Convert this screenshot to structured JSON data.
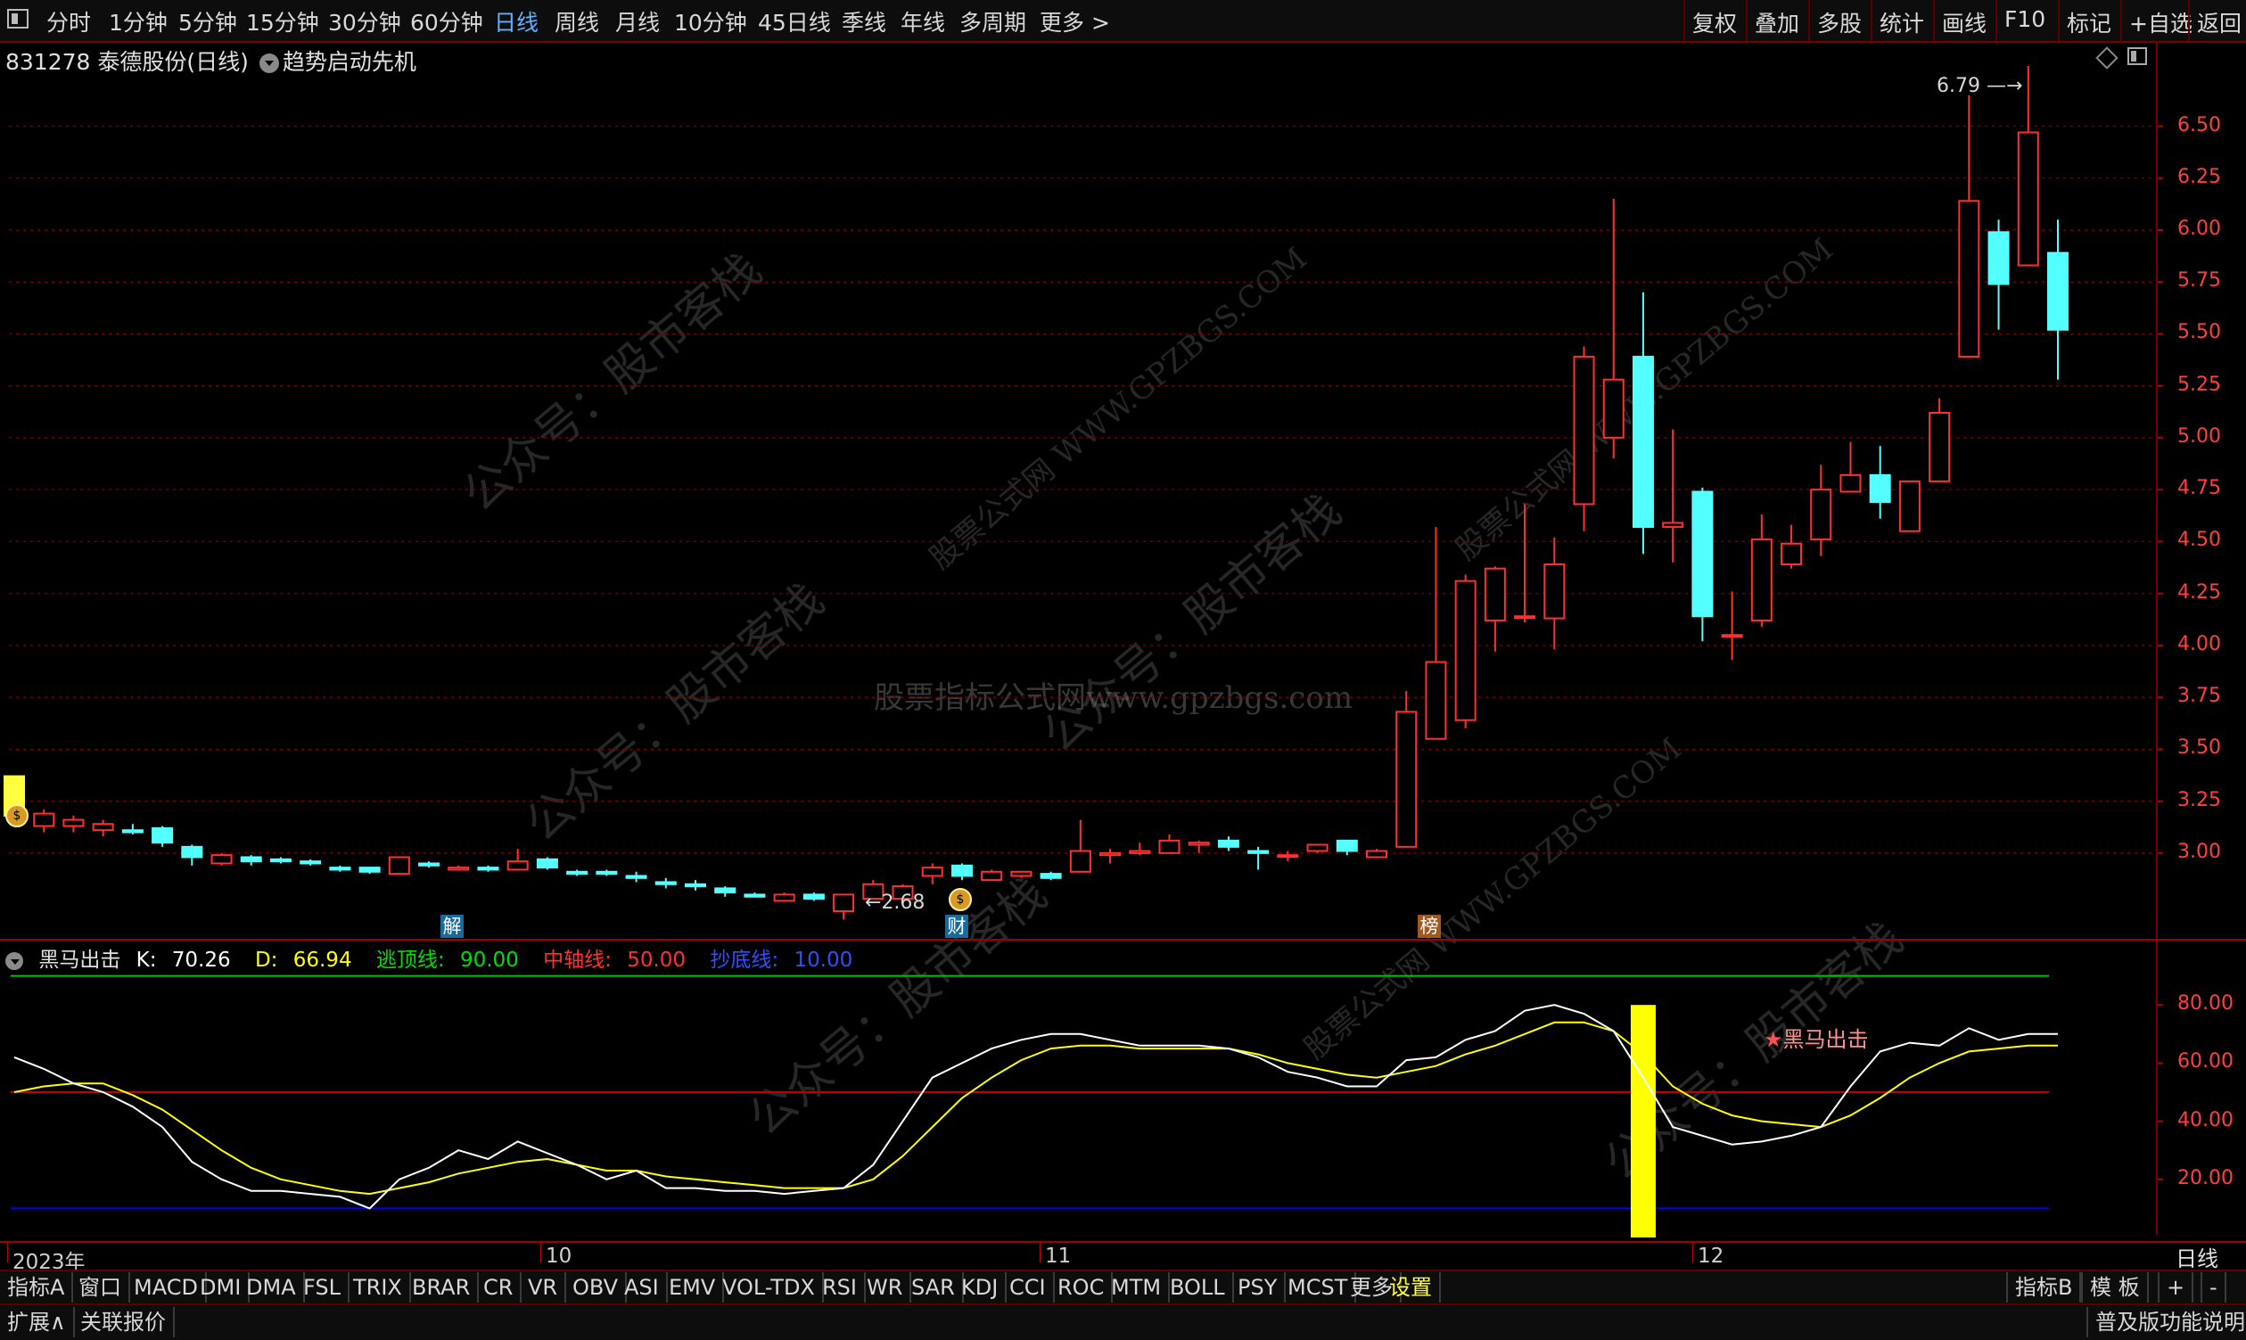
{
  "toolbar": {
    "periods": [
      "分时",
      "1分钟",
      "5分钟",
      "15分钟",
      "30分钟",
      "60分钟",
      "日线",
      "周线",
      "月线",
      "10分钟",
      "45日线",
      "季线",
      "年线",
      "多周期",
      "更多 >"
    ],
    "active_period": "日线",
    "right_buttons": [
      "复权",
      "叠加",
      "多股",
      "统计",
      "画线",
      "F10",
      "标记",
      "+自选",
      "返回"
    ]
  },
  "stock": {
    "code": "831278",
    "name": "泰德股份(日线)",
    "formula": "趋势启动先机"
  },
  "price_axis": {
    "labels": [
      "6.50",
      "6.25",
      "6.00",
      "5.75",
      "5.50",
      "5.25",
      "5.00",
      "4.75",
      "4.50",
      "4.25",
      "4.00",
      "3.75",
      "3.50",
      "3.25",
      "3.00"
    ]
  },
  "annotations": {
    "high": "6.79",
    "low": "2.68",
    "marker_jie": "解",
    "marker_cai": "财",
    "marker_bang": "榜",
    "signal_label": "黑马出击"
  },
  "indicator": {
    "name": "黑马出击",
    "k_label": "K:",
    "k_value": "70.26",
    "d_label": "D:",
    "d_value": "66.94",
    "top_label": "逃顶线:",
    "top_value": "90.00",
    "mid_label": "中轴线:",
    "mid_value": "50.00",
    "bottom_label": "抄底线:",
    "bottom_value": "10.00",
    "axis_labels": [
      "80.00",
      "60.00",
      "40.00",
      "20.00"
    ]
  },
  "time_axis": {
    "labels": [
      "2023年",
      "10",
      "11",
      "12"
    ],
    "right_label": "日线"
  },
  "indicator_tabs": [
    "指标A",
    "窗口",
    "MACD",
    "DMI",
    "DMA",
    "FSL",
    "TRIX",
    "BRAR",
    "CR",
    "VR",
    "OBV",
    "ASI",
    "EMV",
    "VOL-TDX",
    "RSI",
    "WR",
    "SAR",
    "KDJ",
    "CCI",
    "ROC",
    "MTM",
    "BOLL",
    "PSY",
    "MCST",
    "更多",
    "设置"
  ],
  "indicator_tabs_right": [
    "指标B",
    "模 板",
    "+",
    "-"
  ],
  "status_bar": {
    "left": [
      "扩展∧",
      "关联报价"
    ],
    "right": "普及版功能说明"
  },
  "watermarks": [
    "公众号：股市客栈",
    "股票公式网 WWW.GPZBGS.COM",
    "股票指标公式网www.gpzbgs.com"
  ],
  "colors": {
    "up": "#ff3030",
    "down": "#54ffff",
    "k_line": "#ffffff",
    "d_line": "#ffff00",
    "top_line": "#00c000",
    "mid_line": "#c00000",
    "bottom_line": "#0000ff",
    "signal_bar": "#ffff00",
    "grid": "#7a0000"
  },
  "chart_data": {
    "type": "candlestick",
    "price_ylim": [
      2.6,
      6.85
    ],
    "candles": [
      [
        3.37,
        3.18,
        3.37,
        3.16
      ],
      [
        3.13,
        3.19,
        3.21,
        3.1
      ],
      [
        3.13,
        3.16,
        3.18,
        3.1
      ],
      [
        3.11,
        3.14,
        3.16,
        3.08
      ],
      [
        3.11,
        3.1,
        3.14,
        3.09
      ],
      [
        3.12,
        3.05,
        3.13,
        3.03
      ],
      [
        3.03,
        2.98,
        3.04,
        2.94
      ],
      [
        2.95,
        2.99,
        3.0,
        2.94
      ],
      [
        2.98,
        2.96,
        2.99,
        2.94
      ],
      [
        2.97,
        2.96,
        2.98,
        2.95
      ],
      [
        2.96,
        2.95,
        2.97,
        2.94
      ],
      [
        2.93,
        2.92,
        2.94,
        2.91
      ],
      [
        2.93,
        2.91,
        2.93,
        2.9
      ],
      [
        2.9,
        2.98,
        2.98,
        2.9
      ],
      [
        2.95,
        2.94,
        2.96,
        2.93
      ],
      [
        2.92,
        2.93,
        2.94,
        2.92
      ],
      [
        2.93,
        2.92,
        2.94,
        2.91
      ],
      [
        2.92,
        2.96,
        3.02,
        2.92
      ],
      [
        2.97,
        2.93,
        2.98,
        2.92
      ],
      [
        2.91,
        2.9,
        2.92,
        2.89
      ],
      [
        2.91,
        2.9,
        2.92,
        2.89
      ],
      [
        2.89,
        2.88,
        2.91,
        2.86
      ],
      [
        2.86,
        2.85,
        2.88,
        2.83
      ],
      [
        2.85,
        2.84,
        2.87,
        2.82
      ],
      [
        2.83,
        2.81,
        2.84,
        2.79
      ],
      [
        2.8,
        2.79,
        2.81,
        2.79
      ],
      [
        2.77,
        2.8,
        2.81,
        2.77
      ],
      [
        2.8,
        2.78,
        2.81,
        2.77
      ],
      [
        2.72,
        2.8,
        2.8,
        2.68
      ],
      [
        2.78,
        2.85,
        2.87,
        2.78
      ],
      [
        2.78,
        2.84,
        2.85,
        2.78
      ],
      [
        2.89,
        2.93,
        2.95,
        2.85
      ],
      [
        2.94,
        2.89,
        2.95,
        2.87
      ],
      [
        2.87,
        2.91,
        2.92,
        2.87
      ],
      [
        2.89,
        2.91,
        2.91,
        2.88
      ],
      [
        2.9,
        2.88,
        2.91,
        2.87
      ],
      [
        2.91,
        3.01,
        3.16,
        2.91
      ],
      [
        2.99,
        3.0,
        3.02,
        2.95
      ],
      [
        3.0,
        3.01,
        3.05,
        2.99
      ],
      [
        3.0,
        3.06,
        3.09,
        3.0
      ],
      [
        3.04,
        3.05,
        3.06,
        3.0
      ],
      [
        3.06,
        3.03,
        3.08,
        3.01
      ],
      [
        3.01,
        3.0,
        3.03,
        2.92
      ],
      [
        2.99,
        2.99,
        3.01,
        2.96
      ],
      [
        3.01,
        3.04,
        3.04,
        3.0
      ],
      [
        3.06,
        3.01,
        3.06,
        2.99
      ],
      [
        2.98,
        3.01,
        3.02,
        2.98
      ],
      [
        3.03,
        3.68,
        3.78,
        3.03
      ],
      [
        3.55,
        3.92,
        4.57,
        3.55
      ],
      [
        3.64,
        4.31,
        4.34,
        3.6
      ],
      [
        4.12,
        4.37,
        4.38,
        3.97
      ],
      [
        4.14,
        4.14,
        4.68,
        4.11
      ],
      [
        4.13,
        4.39,
        4.52,
        3.98
      ],
      [
        4.68,
        5.39,
        5.44,
        4.55
      ],
      [
        5.0,
        5.28,
        6.15,
        4.9
      ],
      [
        5.39,
        4.57,
        5.7,
        4.44
      ],
      [
        4.57,
        4.59,
        5.04,
        4.4
      ],
      [
        4.74,
        4.14,
        4.76,
        4.02
      ],
      [
        4.05,
        4.05,
        4.26,
        3.93
      ],
      [
        4.12,
        4.51,
        4.63,
        4.09
      ],
      [
        4.39,
        4.49,
        4.58,
        4.37
      ],
      [
        4.51,
        4.75,
        4.87,
        4.43
      ],
      [
        4.74,
        4.82,
        4.98,
        4.74
      ],
      [
        4.82,
        4.69,
        4.96,
        4.61
      ],
      [
        4.55,
        4.79,
        4.79,
        4.55
      ],
      [
        4.79,
        5.12,
        5.19,
        4.79
      ],
      [
        5.39,
        6.14,
        6.65,
        5.39
      ],
      [
        5.99,
        5.74,
        6.05,
        5.52
      ],
      [
        5.83,
        6.47,
        6.79,
        5.83
      ],
      [
        5.89,
        5.52,
        6.05,
        5.28
      ]
    ],
    "kdj": {
      "ylim": [
        0,
        100
      ],
      "k": [
        62,
        58,
        53,
        50,
        45,
        38,
        26,
        20,
        16,
        16,
        15,
        14,
        10,
        20,
        24,
        30,
        27,
        33,
        29,
        25,
        20,
        23,
        17,
        17,
        16,
        16,
        15,
        16,
        17,
        25,
        40,
        55,
        60,
        65,
        68,
        70,
        70,
        68,
        66,
        66,
        66,
        65,
        62,
        57,
        55,
        52,
        52,
        61,
        62,
        68,
        71,
        78,
        80,
        77,
        71,
        55,
        38,
        35,
        32,
        33,
        35,
        38,
        52,
        64,
        67,
        66,
        72,
        68,
        70,
        70
      ],
      "d": [
        50,
        52,
        53,
        53,
        49,
        44,
        37,
        30,
        24,
        20,
        18,
        16,
        15,
        17,
        19,
        22,
        24,
        26,
        27,
        25,
        23,
        23,
        21,
        20,
        19,
        18,
        17,
        17,
        17,
        20,
        28,
        38,
        48,
        55,
        61,
        65,
        66,
        66,
        65,
        65,
        65,
        65,
        63,
        60,
        58,
        56,
        55,
        57,
        59,
        63,
        66,
        70,
        74,
        74,
        71,
        63,
        52,
        46,
        42,
        40,
        39,
        38,
        42,
        48,
        55,
        60,
        64,
        65,
        66,
        66
      ]
    }
  }
}
